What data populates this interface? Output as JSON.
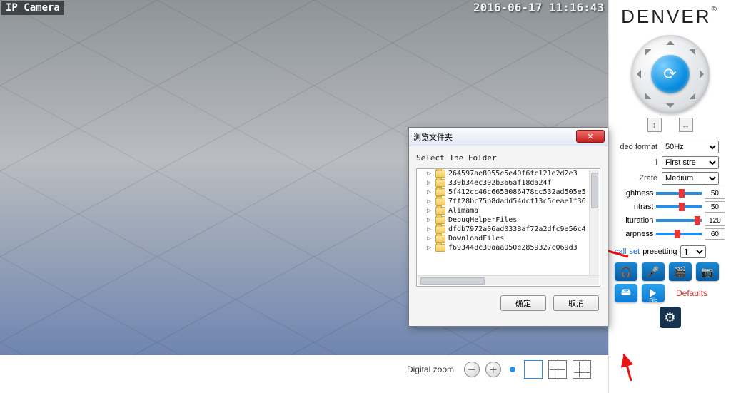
{
  "video": {
    "camera_label": "IP Camera",
    "timestamp": "2016-06-17 11:16:43"
  },
  "zoom": {
    "label": "Digital zoom"
  },
  "brand": "DENVER",
  "settings": {
    "video_format": {
      "label": "deo format",
      "value": "50Hz"
    },
    "stream": {
      "label": "i",
      "value": "First stre"
    },
    "zrate": {
      "label": "Zrate",
      "value": "Medium"
    }
  },
  "sliders": {
    "brightness": {
      "label": "ightness",
      "value": "50",
      "pct": 50
    },
    "contrast": {
      "label": "ntrast",
      "value": "50",
      "pct": 50
    },
    "saturation": {
      "label": "ituration",
      "value": "120",
      "pct": 85
    },
    "sharpness": {
      "label": "arpness",
      "value": "60",
      "pct": 40
    }
  },
  "preset": {
    "call": "call",
    "set": "set",
    "label": "presetting",
    "value": "1"
  },
  "defaults_label": "Defaults",
  "dialog": {
    "title": "浏览文件夹",
    "subtitle": "Select The Folder",
    "items": [
      "264597ae8055c5e40f6fc121e2d2e3",
      "330b34ec302b366af18da24f",
      "5f412cc46c6653086478cc532ad505e5",
      "7ff28bc75b8dadd54dcf13c5ceae1f36",
      "Alimama",
      "DebugHelperFiles",
      "dfdb7972a06ad0338af72a2dfc9e56c4",
      "DownloadFiles",
      "f693448c30aaa050e2859327c069d3"
    ],
    "ok": "确定",
    "cancel": "取消"
  }
}
